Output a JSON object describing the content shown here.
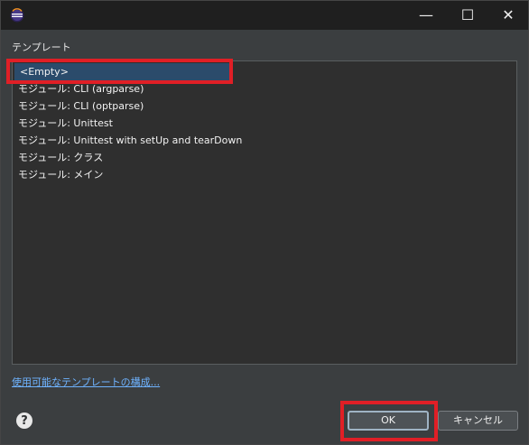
{
  "window": {
    "icons": {
      "app": "eclipse-icon",
      "minimize": "minimize-icon",
      "maximize": "maximize-icon",
      "close": "close-icon"
    },
    "minimize_glyph": "—",
    "maximize_glyph": "☐",
    "close_glyph": "✕"
  },
  "templates": {
    "label": "テンプレート",
    "items": [
      "<Empty>",
      "モジュール: CLI (argparse)",
      "モジュール: CLI (optparse)",
      "モジュール: Unittest",
      "モジュール: Unittest with setUp and tearDown",
      "モジュール: クラス",
      "モジュール: メイン"
    ],
    "selected_index": 0
  },
  "footer": {
    "config_link": "使用可能なテンプレートの構成...",
    "help_glyph": "?",
    "ok_label": "OK",
    "cancel_label": "キャンセル"
  },
  "colors": {
    "highlight": "#e01f26",
    "selection": "#2b4b6b",
    "link": "#6fb3ff"
  }
}
